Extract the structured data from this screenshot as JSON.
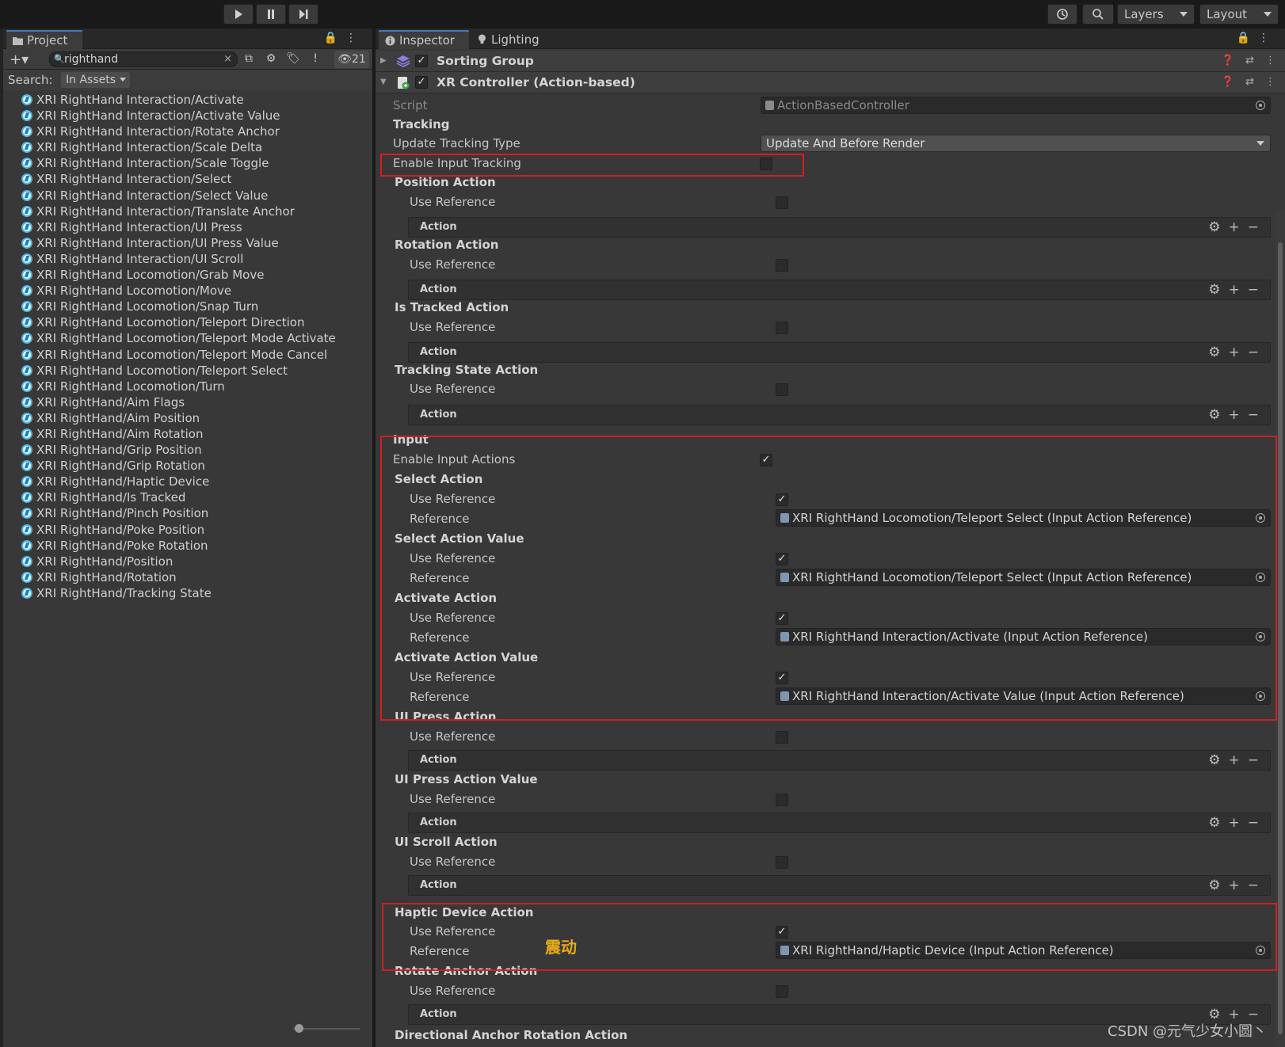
{
  "toolbar": {
    "play_icon": "play-icon",
    "pause_icon": "pause-icon",
    "step_icon": "step-icon",
    "history_icon": "history-icon",
    "search_icon": "search-icon",
    "layers_label": "Layers",
    "layout_label": "Layout"
  },
  "project": {
    "tab_label": "Project",
    "search_value": "righthand",
    "hidden_count": "21",
    "search_label": "Search:",
    "scope_value": "In Assets",
    "assets": [
      "XRI RightHand Interaction/Activate",
      "XRI RightHand Interaction/Activate Value",
      "XRI RightHand Interaction/Rotate Anchor",
      "XRI RightHand Interaction/Scale Delta",
      "XRI RightHand Interaction/Scale Toggle",
      "XRI RightHand Interaction/Select",
      "XRI RightHand Interaction/Select Value",
      "XRI RightHand Interaction/Translate Anchor",
      "XRI RightHand Interaction/UI Press",
      "XRI RightHand Interaction/UI Press Value",
      "XRI RightHand Interaction/UI Scroll",
      "XRI RightHand Locomotion/Grab Move",
      "XRI RightHand Locomotion/Move",
      "XRI RightHand Locomotion/Snap Turn",
      "XRI RightHand Locomotion/Teleport Direction",
      "XRI RightHand Locomotion/Teleport Mode Activate",
      "XRI RightHand Locomotion/Teleport Mode Cancel",
      "XRI RightHand Locomotion/Teleport Select",
      "XRI RightHand Locomotion/Turn",
      "XRI RightHand/Aim Flags",
      "XRI RightHand/Aim Position",
      "XRI RightHand/Aim Rotation",
      "XRI RightHand/Grip Position",
      "XRI RightHand/Grip Rotation",
      "XRI RightHand/Haptic Device",
      "XRI RightHand/Is Tracked",
      "XRI RightHand/Pinch Position",
      "XRI RightHand/Poke Position",
      "XRI RightHand/Poke Rotation",
      "XRI RightHand/Position",
      "XRI RightHand/Rotation",
      "XRI RightHand/Tracking State"
    ]
  },
  "inspector": {
    "tab_label": "Inspector",
    "lighting_tab_label": "Lighting",
    "sorting_group_title": "Sorting Group",
    "xr_controller_title": "XR Controller (Action-based)",
    "script_label": "Script",
    "script_value": "ActionBasedController",
    "tracking_header": "Tracking",
    "update_tracking_type_label": "Update Tracking Type",
    "update_tracking_type_value": "Update And Before Render",
    "enable_input_tracking_label": "Enable Input Tracking",
    "use_reference_label": "Use Reference",
    "reference_label": "Reference",
    "action_label": "Action",
    "position_action": "Position Action",
    "rotation_action": "Rotation Action",
    "is_tracked_action": "Is Tracked Action",
    "tracking_state_action": "Tracking State Action",
    "input_header": "Input",
    "enable_input_actions_label": "Enable Input Actions",
    "select_action": "Select Action",
    "select_action_ref": "XRI RightHand Locomotion/Teleport Select (Input Action Reference)",
    "select_action_value": "Select Action Value",
    "select_action_value_ref": "XRI RightHand Locomotion/Teleport Select (Input Action Reference)",
    "activate_action": "Activate Action",
    "activate_action_ref": "XRI RightHand Interaction/Activate (Input Action Reference)",
    "activate_action_value": "Activate Action Value",
    "activate_action_value_ref": "XRI RightHand Interaction/Activate Value (Input Action Reference)",
    "ui_press_action": "UI Press Action",
    "ui_press_action_value": "UI Press Action Value",
    "ui_scroll_action": "UI Scroll Action",
    "haptic_device_action": "Haptic Device Action",
    "haptic_device_ref": "XRI RightHand/Haptic Device (Input Action Reference)",
    "rotate_anchor_action": "Rotate Anchor Action",
    "directional_anchor_rotation_action": "Directional Anchor Rotation Action"
  },
  "annotation_text": "震动",
  "watermark": "CSDN @元气少女小圆丶",
  "colors": {
    "highlight_box": "#d11f1f",
    "annotation": "#e8a817",
    "tab_accent": "#3a79bb"
  }
}
